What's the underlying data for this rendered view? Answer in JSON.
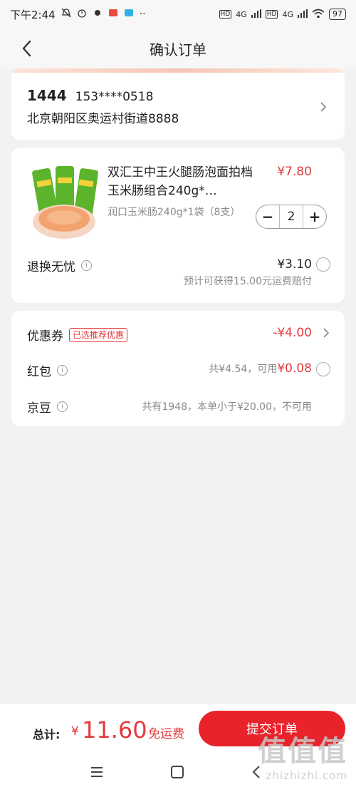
{
  "status_bar": {
    "time": "下午2:44",
    "network_1": "4G",
    "network_2": "4G",
    "hd_1": "HD",
    "hd_2": "HD",
    "battery": "97",
    "app_icon_colors": [
      "#e84a3c",
      "#34b0e5"
    ]
  },
  "nav": {
    "title": "确认订单"
  },
  "address": {
    "name": "1444",
    "phone": "153****0518",
    "detail": "北京朝阳区奥运村街道8888"
  },
  "product": {
    "title": "双汇王中王火腿肠泡面拍档玉米肠组合240g*…",
    "price": "¥7.80",
    "spec": "润口玉米肠240g*1袋（8支）",
    "quantity": "2",
    "minus": "−",
    "plus": "+",
    "image_colors": [
      "#5bb42c",
      "#f2a36f"
    ]
  },
  "return_service": {
    "label": "退换无忧",
    "price": "¥3.10",
    "note": "预计可获得15.00元运费赔付"
  },
  "discounts": {
    "coupon_label": "优惠券",
    "coupon_badge": "已选推荐优惠",
    "coupon_value": "-¥4.00",
    "redpacket_label": "红包",
    "redpacket_total": "共¥4.54，可用",
    "redpacket_value": "¥0.08",
    "jd_bean_label": "京豆",
    "jd_bean_note": "共有1948，本单小于¥20.00，不可用"
  },
  "bottom": {
    "total_label": "总计:",
    "currency": "¥",
    "total_amount": "11.60",
    "free_shipping": "免运费",
    "submit": "提交订单"
  },
  "watermark": {
    "big": "值值值",
    "small": "zhizhizhi.com"
  },
  "colors": {
    "accent_red": "#e4393c",
    "button_red": "#e8232b",
    "background": "#f2f2f2"
  }
}
